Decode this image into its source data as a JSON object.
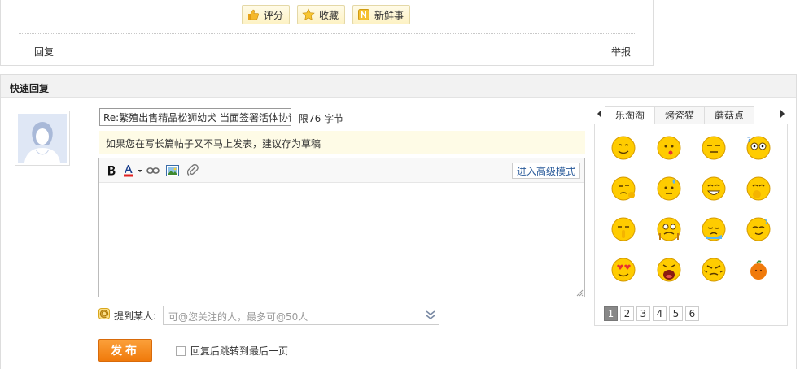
{
  "post_actions": {
    "rate_label": "评分",
    "favorite_label": "收藏",
    "news_label": "新鲜事",
    "reply_link": "回复",
    "report_link": "举报"
  },
  "quick_reply": {
    "heading": "快速回复",
    "title_value": "Re:繁殖出售精品松狮幼犬 当面签署活体协议",
    "limit_text": "限76 字节",
    "tip_text": "如果您在写长篇帖子又不马上发表，建议存为草稿",
    "toolbar": {
      "bold_icon": "bold-icon",
      "font_color_icon": "font-color-icon",
      "link_icon": "link-icon",
      "image_icon": "image-icon",
      "attachment_icon": "attachment-icon",
      "advanced_mode_label": "进入高级模式"
    },
    "editor_value": "",
    "mention": {
      "label": "提到某人:",
      "placeholder": "可@您关注的人，最多可@50人"
    },
    "submit_label": "发布",
    "jump_label": "回复后跳转到最后一页",
    "jump_checked": false
  },
  "emoticons": {
    "tabs": [
      "乐淘淘",
      "烤瓷猫",
      "蘑菇点"
    ],
    "active_tab": "乐淘淘",
    "icons": [
      "smile-face-icon",
      "kiss-face-icon",
      "squint-face-icon",
      "confused-face-icon",
      "thinking-face-icon",
      "sweat-face-icon",
      "laughing-face-icon",
      "giggle-face-icon",
      "shush-face-icon",
      "nervous-face-icon",
      "crying-face-icon",
      "smug-face-icon",
      "heart-eyes-face-icon",
      "shouting-face-icon",
      "angry-face-icon",
      "orange-face-icon"
    ],
    "pages": [
      "1",
      "2",
      "3",
      "4",
      "5",
      "6"
    ],
    "active_page": "1"
  },
  "colors": {
    "accent_orange": "#f07a0b",
    "emoji_yellow": "#ffcc00",
    "tip_bg": "#fefbe6"
  }
}
